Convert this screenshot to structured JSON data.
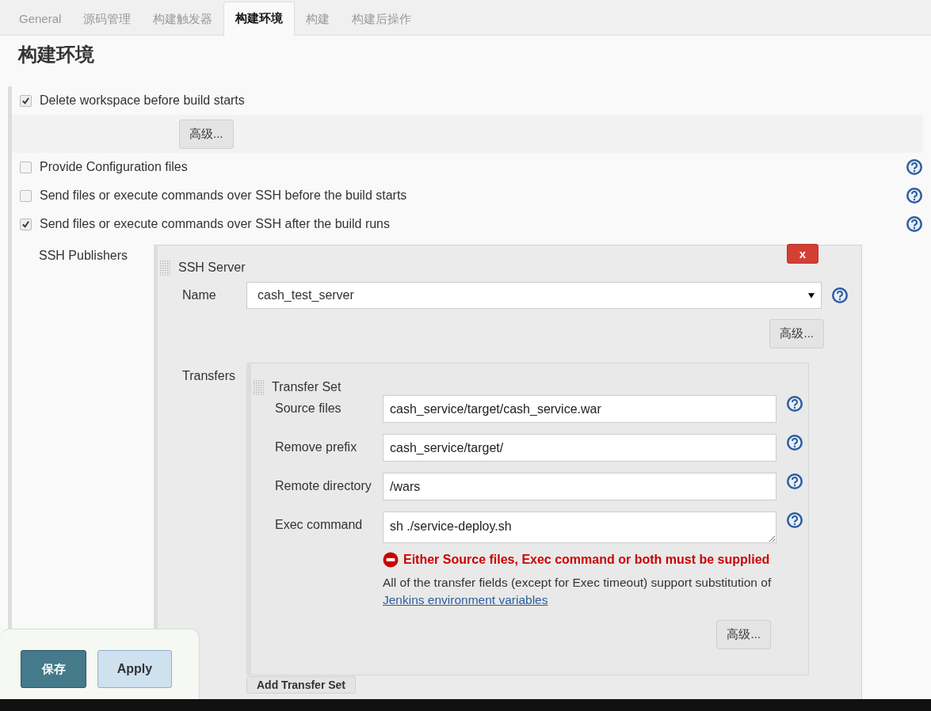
{
  "tabs": [
    {
      "label": "General",
      "selected": false
    },
    {
      "label": "源码管理",
      "selected": false
    },
    {
      "label": "构建触发器",
      "selected": false
    },
    {
      "label": "构建环境",
      "selected": true
    },
    {
      "label": "构建",
      "selected": false
    },
    {
      "label": "构建后操作",
      "selected": false
    }
  ],
  "heading": "构建环境",
  "options": [
    {
      "label": "Delete workspace before build starts",
      "checked": true,
      "help": false,
      "advanced_button": "高级..."
    },
    {
      "label": "Provide Configuration files",
      "checked": false,
      "help": true
    },
    {
      "label": "Send files or execute commands over SSH before the build starts",
      "checked": false,
      "help": true
    },
    {
      "label": "Send files or execute commands over SSH after the build runs",
      "checked": true,
      "help": true
    }
  ],
  "ssh_publishers": {
    "label": "SSH Publishers",
    "close_button": "x",
    "server": {
      "title": "SSH Server",
      "name_label": "Name",
      "name_value": "cash_test_server",
      "advanced_button": "高级...",
      "transfers_label": "Transfers",
      "transfer_set": {
        "title": "Transfer Set",
        "fields": [
          {
            "label": "Source files",
            "value": "cash_service/target/cash_service.war",
            "kind": "input"
          },
          {
            "label": "Remove prefix",
            "value": "cash_service/target/",
            "kind": "input"
          },
          {
            "label": "Remote directory",
            "value": "/wars",
            "kind": "input"
          },
          {
            "label": "Exec command",
            "value": "sh ./service-deploy.sh",
            "kind": "textarea"
          }
        ],
        "error": "Either Source files, Exec command or both must be supplied",
        "note": {
          "text": "All of the transfer fields (except for Exec timeout) support substitution of",
          "link": "Jenkins environment variables"
        },
        "advanced_button": "高级..."
      },
      "add_button": "Add Transfer Set"
    }
  },
  "actions": {
    "save": "保存",
    "apply": "Apply"
  }
}
